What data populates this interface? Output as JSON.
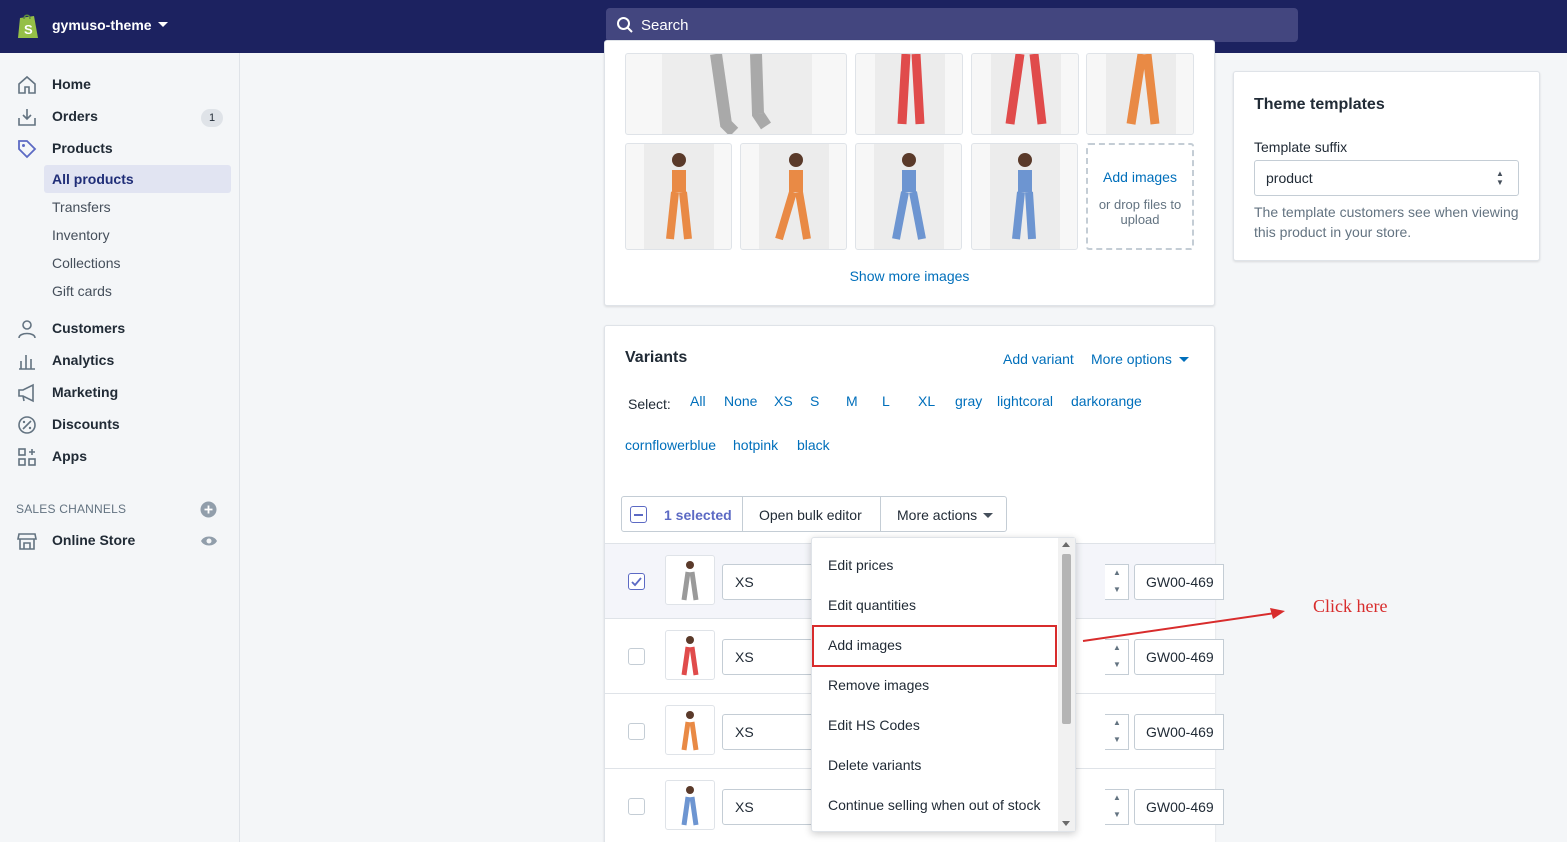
{
  "topbar": {
    "store_name": "gymuso-theme",
    "search_placeholder": "Search"
  },
  "sidebar": {
    "items": [
      {
        "label": "Home"
      },
      {
        "label": "Orders",
        "badge": "1"
      },
      {
        "label": "Products"
      },
      {
        "label": "Customers"
      },
      {
        "label": "Analytics"
      },
      {
        "label": "Marketing"
      },
      {
        "label": "Discounts"
      },
      {
        "label": "Apps"
      }
    ],
    "sub_items": [
      "All products",
      "Transfers",
      "Inventory",
      "Collections",
      "Gift cards"
    ],
    "sales_channels_heading": "SALES CHANNELS",
    "online_store": "Online Store"
  },
  "media": {
    "add_images": "Add images",
    "drop_hint": "or drop files to upload",
    "show_more": "Show more images"
  },
  "variants": {
    "title": "Variants",
    "add_variant": "Add variant",
    "more_options": "More options",
    "select_label": "Select:",
    "select_options": [
      "All",
      "None",
      "XS",
      "S",
      "M",
      "L",
      "XL",
      "gray",
      "lightcoral",
      "darkorange",
      "cornflowerblue",
      "hotpink",
      "black"
    ],
    "bulk": {
      "selected": "1 selected",
      "open_bulk_editor": "Open bulk editor",
      "more_actions": "More actions"
    },
    "rows": [
      {
        "size": "XS",
        "sku": "GW00-469",
        "selected": true,
        "color": "#9a9a9a"
      },
      {
        "size": "XS",
        "sku": "GW00-469",
        "selected": false,
        "color": "#e04b4b"
      },
      {
        "size": "XS",
        "sku": "GW00-469",
        "selected": false,
        "color": "#e98a45"
      },
      {
        "size": "XS",
        "sku": "GW00-469",
        "selected": false,
        "color": "#6d95d1"
      }
    ]
  },
  "dropdown": {
    "items": [
      "Edit prices",
      "Edit quantities",
      "Add images",
      "Remove images",
      "Edit HS Codes",
      "Delete variants",
      "Continue selling when out of stock"
    ]
  },
  "theme_templates": {
    "title": "Theme templates",
    "field_label": "Template suffix",
    "value": "product",
    "help": "The template customers see when viewing this product in your store."
  },
  "annotation": {
    "text": "Click here",
    "color": "#d82c2c"
  }
}
